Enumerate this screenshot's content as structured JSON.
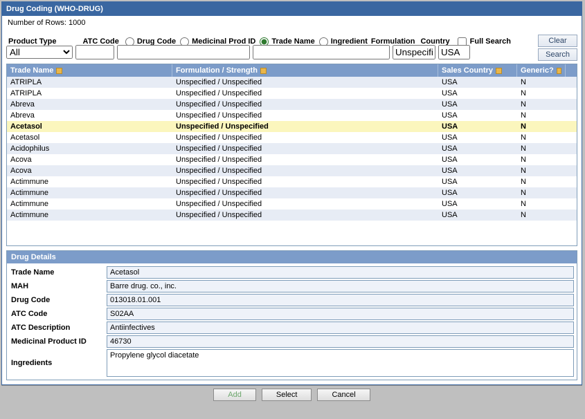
{
  "window": {
    "title": "Drug Coding (WHO-DRUG)"
  },
  "row_count": "Number of Rows: 1000",
  "filters": {
    "product_type_label": "Product Type",
    "atc_code_label": "ATC Code",
    "formulation_label": "Formulation",
    "country_label": "Country",
    "full_search_label": "Full Search",
    "radios": {
      "drug_code": "Drug Code",
      "medicinal_prod_id": "Medicinal Prod ID",
      "trade_name": "Trade Name",
      "ingredient": "Ingredient"
    },
    "values": {
      "product_type": "All",
      "atc_code": "",
      "drug_code": "",
      "trade_name": "",
      "formulation": "Unspecified",
      "country": "USA"
    },
    "clear_btn": "Clear",
    "search_btn": "Search"
  },
  "grid": {
    "headers": {
      "trade_name": "Trade Name",
      "formulation": "Formulation / Strength",
      "sales_country": "Sales Country",
      "generic": "Generic?"
    },
    "rows": [
      {
        "trade": "ATRIPLA",
        "form": "Unspecified / Unspecified",
        "country": "USA",
        "generic": "N",
        "alt": true
      },
      {
        "trade": "ATRIPLA",
        "form": "Unspecified / Unspecified",
        "country": "USA",
        "generic": "N",
        "alt": false
      },
      {
        "trade": "Abreva",
        "form": "Unspecified / Unspecified",
        "country": "USA",
        "generic": "N",
        "alt": true
      },
      {
        "trade": "Abreva",
        "form": "Unspecified / Unspecified",
        "country": "USA",
        "generic": "N",
        "alt": false
      },
      {
        "trade": "Acetasol",
        "form": "Unspecified / Unspecified",
        "country": "USA",
        "generic": "N",
        "sel": true
      },
      {
        "trade": "Acetasol",
        "form": "Unspecified / Unspecified",
        "country": "USA",
        "generic": "N",
        "alt": false
      },
      {
        "trade": "Acidophilus",
        "form": "Unspecified / Unspecified",
        "country": "USA",
        "generic": "N",
        "alt": true
      },
      {
        "trade": "Acova",
        "form": "Unspecified / Unspecified",
        "country": "USA",
        "generic": "N",
        "alt": false
      },
      {
        "trade": "Acova",
        "form": "Unspecified / Unspecified",
        "country": "USA",
        "generic": "N",
        "alt": true
      },
      {
        "trade": "Actimmune",
        "form": "Unspecified / Unspecified",
        "country": "USA",
        "generic": "N",
        "alt": false
      },
      {
        "trade": "Actimmune",
        "form": "Unspecified / Unspecified",
        "country": "USA",
        "generic": "N",
        "alt": true
      },
      {
        "trade": "Actimmune",
        "form": "Unspecified / Unspecified",
        "country": "USA",
        "generic": "N",
        "alt": false
      },
      {
        "trade": "Actimmune",
        "form": "Unspecified / Unspecified",
        "country": "USA",
        "generic": "N",
        "alt": true
      }
    ]
  },
  "details": {
    "header": "Drug Details",
    "labels": {
      "trade_name": "Trade Name",
      "mah": "MAH",
      "drug_code": "Drug Code",
      "atc_code": "ATC Code",
      "atc_desc": "ATC Description",
      "med_prod_id": "Medicinal Product ID",
      "ingredients": "Ingredients"
    },
    "values": {
      "trade_name": "Acetasol",
      "mah": "Barre drug. co., inc.",
      "drug_code": "013018.01.001",
      "atc_code": "S02AA",
      "atc_desc": "Antiinfectives",
      "med_prod_id": "46730",
      "ingredients": "Propylene glycol diacetate"
    }
  },
  "footer": {
    "add": "Add",
    "select": "Select",
    "cancel": "Cancel"
  }
}
